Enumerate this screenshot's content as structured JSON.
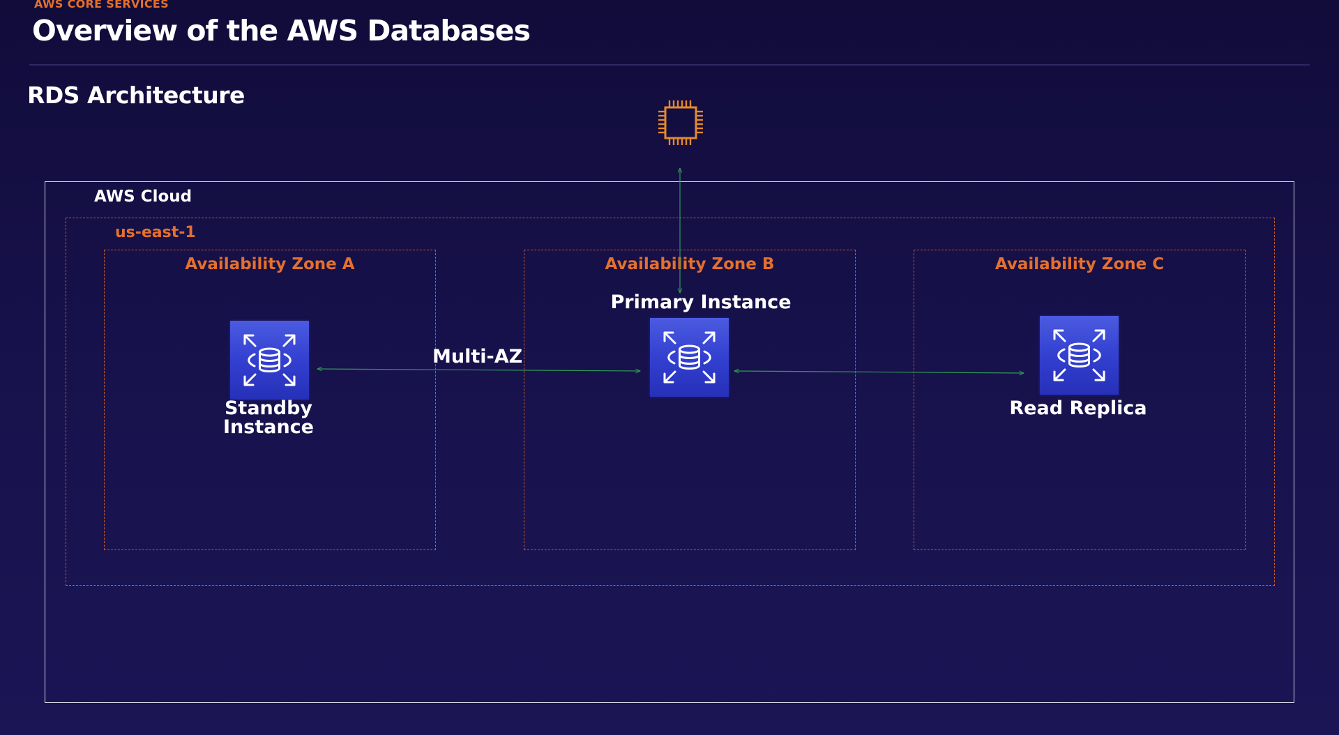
{
  "header": {
    "kicker": "AWS CORE SERVICES",
    "title": "Overview of the AWS Databases"
  },
  "slide": {
    "subtitle": "RDS Architecture"
  },
  "diagram": {
    "cloud_label": "AWS Cloud",
    "region_label": "us-east-1",
    "zones": [
      {
        "label": "Availability Zone A"
      },
      {
        "label": "Availability Zone B"
      },
      {
        "label": "Availability Zone C"
      }
    ],
    "nodes": {
      "standby": {
        "label_line1": "Standby",
        "label_line2": "Instance",
        "icon": "rds-database-icon"
      },
      "primary": {
        "label": "Primary Instance",
        "icon": "rds-database-icon"
      },
      "replica": {
        "label": "Read Replica",
        "icon": "rds-database-icon"
      },
      "compute": {
        "icon": "ec2-chip-icon"
      }
    },
    "edges": {
      "multi_az_label": "Multi-AZ"
    },
    "colors": {
      "accent_orange": "#e4702d",
      "connector_green": "#2f9a57",
      "db_icon_blue": "#3a47d6",
      "background": "#17114b"
    }
  }
}
